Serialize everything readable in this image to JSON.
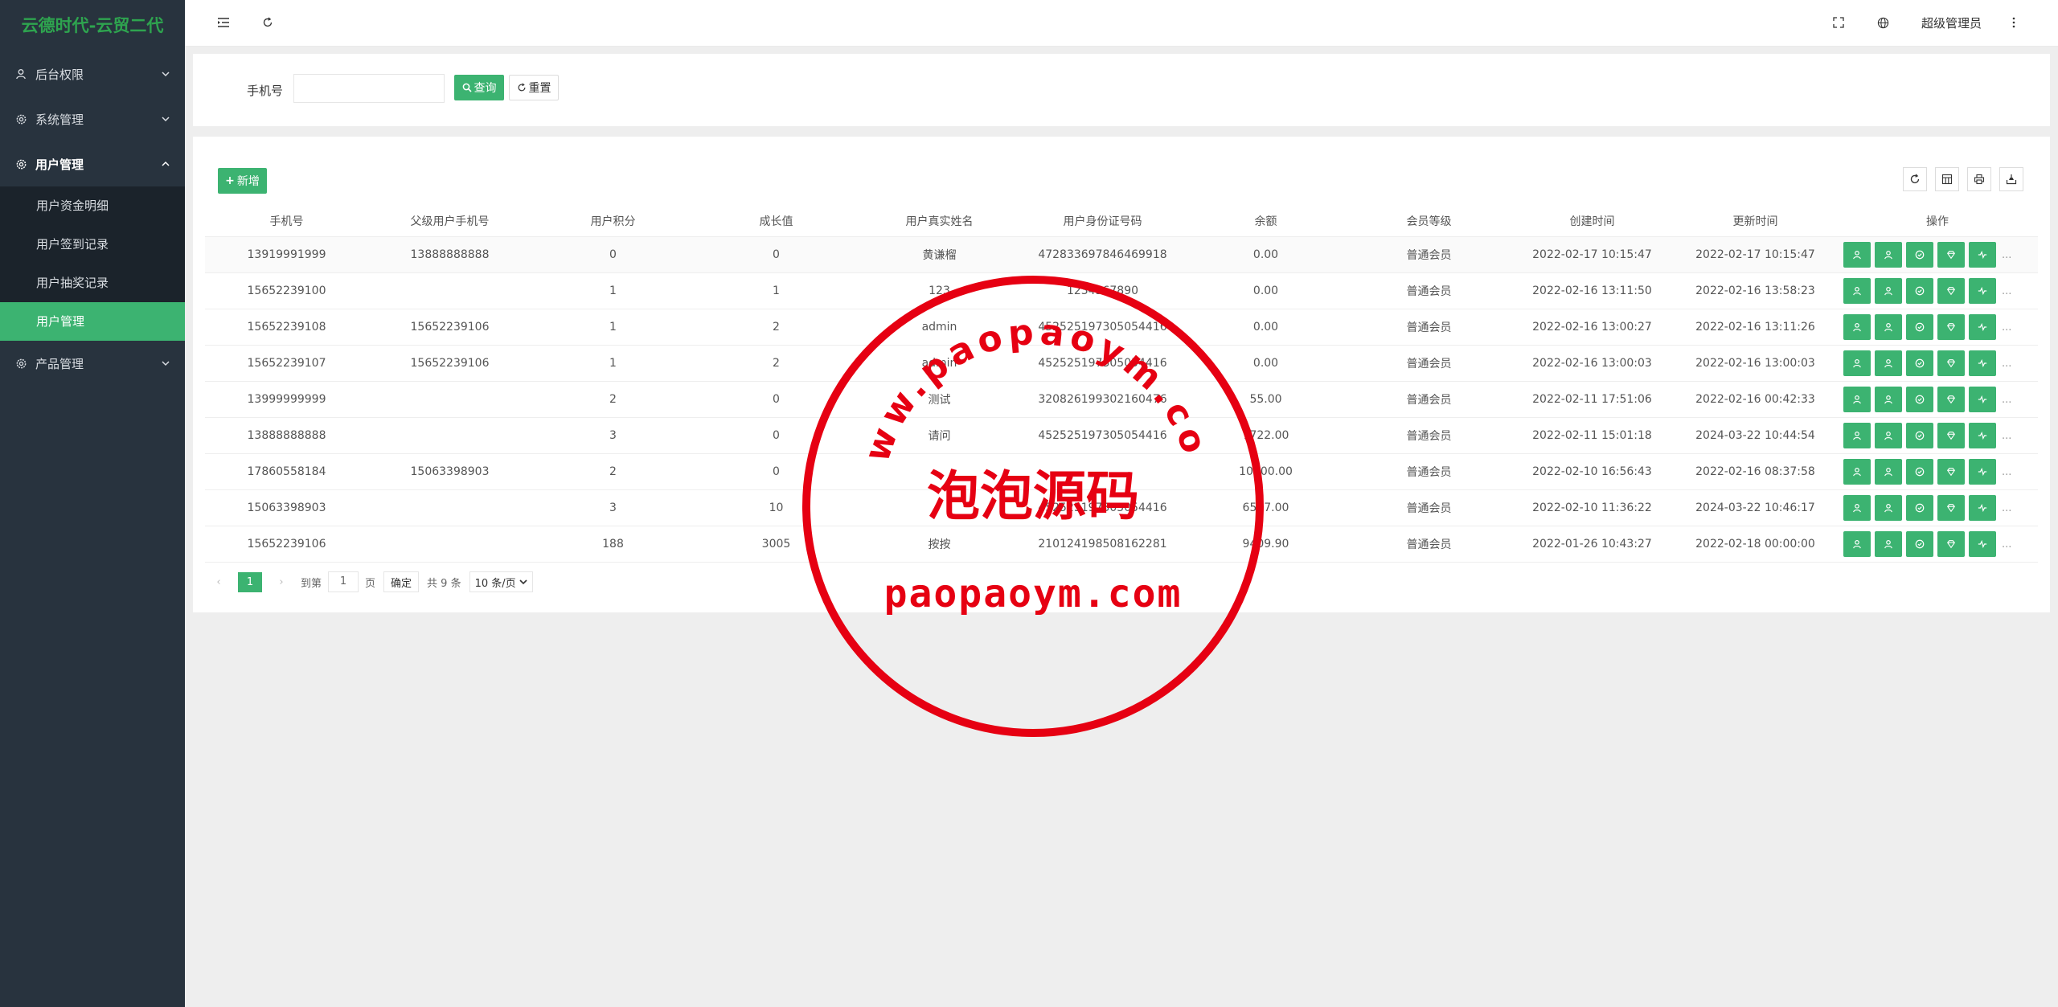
{
  "app": {
    "title": "云德时代-云贸二代"
  },
  "colors": {
    "accent": "#3cb371",
    "sidebar": "#28333e",
    "stamp": "#e60012"
  },
  "sidebar": {
    "groups": [
      {
        "label": "后台权限",
        "icon": "user-icon"
      },
      {
        "label": "系统管理",
        "icon": "gear-icon"
      },
      {
        "label": "用户管理",
        "icon": "gear-icon",
        "open": true
      },
      {
        "label": "产品管理",
        "icon": "gear-icon"
      }
    ],
    "sub_items": [
      {
        "label": "用户资金明细"
      },
      {
        "label": "用户签到记录"
      },
      {
        "label": "用户抽奖记录"
      },
      {
        "label": "用户管理",
        "active": true
      }
    ]
  },
  "topbar": {
    "admin_label": "超级管理员"
  },
  "search": {
    "phone_label": "手机号",
    "phone_value": "",
    "query_label": "查询",
    "reset_label": "重置"
  },
  "table": {
    "add_label": "新增",
    "columns": [
      "手机号",
      "父级用户手机号",
      "用户积分",
      "成长值",
      "用户真实姓名",
      "用户身份证号码",
      "余额",
      "会员等级",
      "创建时间",
      "更新时间",
      "操作"
    ],
    "rows": [
      [
        "13919991999",
        "13888888888",
        "0",
        "0",
        "黄谦榴",
        "472833697846469918",
        "0.00",
        "普通会员",
        "2022-02-17 10:15:47",
        "2022-02-17 10:15:47"
      ],
      [
        "15652239100",
        "",
        "1",
        "1",
        "123",
        "1234567890",
        "0.00",
        "普通会员",
        "2022-02-16 13:11:50",
        "2022-02-16 13:58:23"
      ],
      [
        "15652239108",
        "15652239106",
        "1",
        "2",
        "admin",
        "452525197305054416",
        "0.00",
        "普通会员",
        "2022-02-16 13:00:27",
        "2022-02-16 13:11:26"
      ],
      [
        "15652239107",
        "15652239106",
        "1",
        "2",
        "admin",
        "452525197305054416",
        "0.00",
        "普通会员",
        "2022-02-16 13:00:03",
        "2022-02-16 13:00:03"
      ],
      [
        "13999999999",
        "",
        "2",
        "0",
        "测试",
        "320826199302160476",
        "55.00",
        "普通会员",
        "2022-02-11 17:51:06",
        "2022-02-16 00:42:33"
      ],
      [
        "13888888888",
        "",
        "3",
        "0",
        "请问",
        "452525197305054416",
        "7722.00",
        "普通会员",
        "2022-02-11 15:01:18",
        "2024-03-22 10:44:54"
      ],
      [
        "17860558184",
        "15063398903",
        "2",
        "0",
        "",
        "",
        "10000.00",
        "普通会员",
        "2022-02-10 16:56:43",
        "2022-02-16 08:37:58"
      ],
      [
        "15063398903",
        "",
        "3",
        "10",
        "",
        "452525197305054416",
        "6567.00",
        "普通会员",
        "2022-02-10 11:36:22",
        "2024-03-22 10:46:17"
      ],
      [
        "15652239106",
        "",
        "188",
        "3005",
        "按按",
        "210124198508162281",
        "9409.90",
        "普通会员",
        "2022-01-26 10:43:27",
        "2022-02-18 00:00:00"
      ]
    ],
    "op_icons": [
      "user-icon",
      "user-icon",
      "shield-icon",
      "diamond-icon",
      "activity-icon"
    ],
    "more": "..."
  },
  "pagination": {
    "current": "1",
    "goto_label": "到第",
    "goto_value": "1",
    "page_unit": "页",
    "confirm_label": "确定",
    "total_label": "共 9 条",
    "page_size": "10 条/页"
  },
  "watermark": {
    "arc_text": "www.paopaoym.com",
    "center_text": "泡泡源码",
    "bottom_text": "paopaoym.com"
  }
}
